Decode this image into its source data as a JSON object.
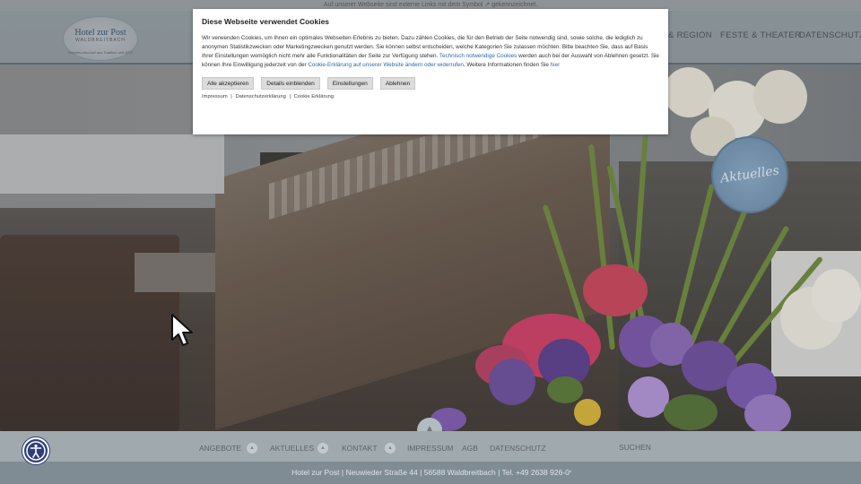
{
  "topline": "Auf unserer Webseite sind externe Links mit dem Symbol ↗ gekennzeichnet.",
  "logo": {
    "name": "Hotel zur Post",
    "place": "WALDBREITBACH",
    "tagline": "Gastfreundschaft aus Tradition seit 1872"
  },
  "topnav": [
    "& REGION",
    "FESTE & THEATER",
    "DATENSCHUTZ"
  ],
  "badge": "Aktuelles",
  "cookie": {
    "title": "Diese Webseite verwendet Cookies",
    "text1": "Wir verwenden Cookies, um Ihnen ein optimales Webseiten-Erlebnis zu bieten. Dazu zählen Cookies, die für den Betrieb der Seite notwendig sind, sowie solche, die lediglich zu anonymen Statistikzwecken oder Marketingzwecken genutzt werden. Sie können selbst entscheiden, welche Kategorien Sie zulassen möchten. Bitte beachten Sie, dass auf Basis Ihrer Einstellungen womöglich nicht mehr alle Funktionalitäten der Seite zur Verfügung stehen.",
    "link1": "Technisch notwendige Cookies",
    "text2": "werden auch bei der Auswahl von Ablehnen gesetzt. Sie können Ihre Einwilligung jederzeit von der",
    "link2": "Cookie-Erklärung auf unserer Website ändern oder widerrufen",
    "text3": ". Weitere Informationen finden Sie",
    "link3": "hier",
    "buttons": {
      "accept_all": "Alle akzeptieren",
      "details": "Details einblenden",
      "settings": "Einstellungen",
      "reject": "Ablehnen"
    },
    "footer": {
      "impressum": "Impressum",
      "datenschutz": "Datenschutzerklärung",
      "cookie": "Cookie Erklärung",
      "separator": "|"
    }
  },
  "bottomnav": [
    "ANGEBOTE",
    "AKTUELLES",
    "KONTAKT",
    "IMPRESSUM",
    "AGB",
    "DATENSCHUTZ",
    "SUCHEN"
  ],
  "footer": "Hotel zur Post | Neuwieder Straße 44 | 56588 Waldbreitbach | Tel. +49 2638 926-0",
  "colors": {
    "header": "#96a0a6",
    "bottomnav": "#9fa9ae",
    "footer": "#7f8c94",
    "link": "#2b6aa6",
    "accessibility": "#2f3e79"
  },
  "icons": [
    "arrow-up-icon",
    "accessibility-icon",
    "external-link-icon",
    "mouse-cursor-icon"
  ]
}
